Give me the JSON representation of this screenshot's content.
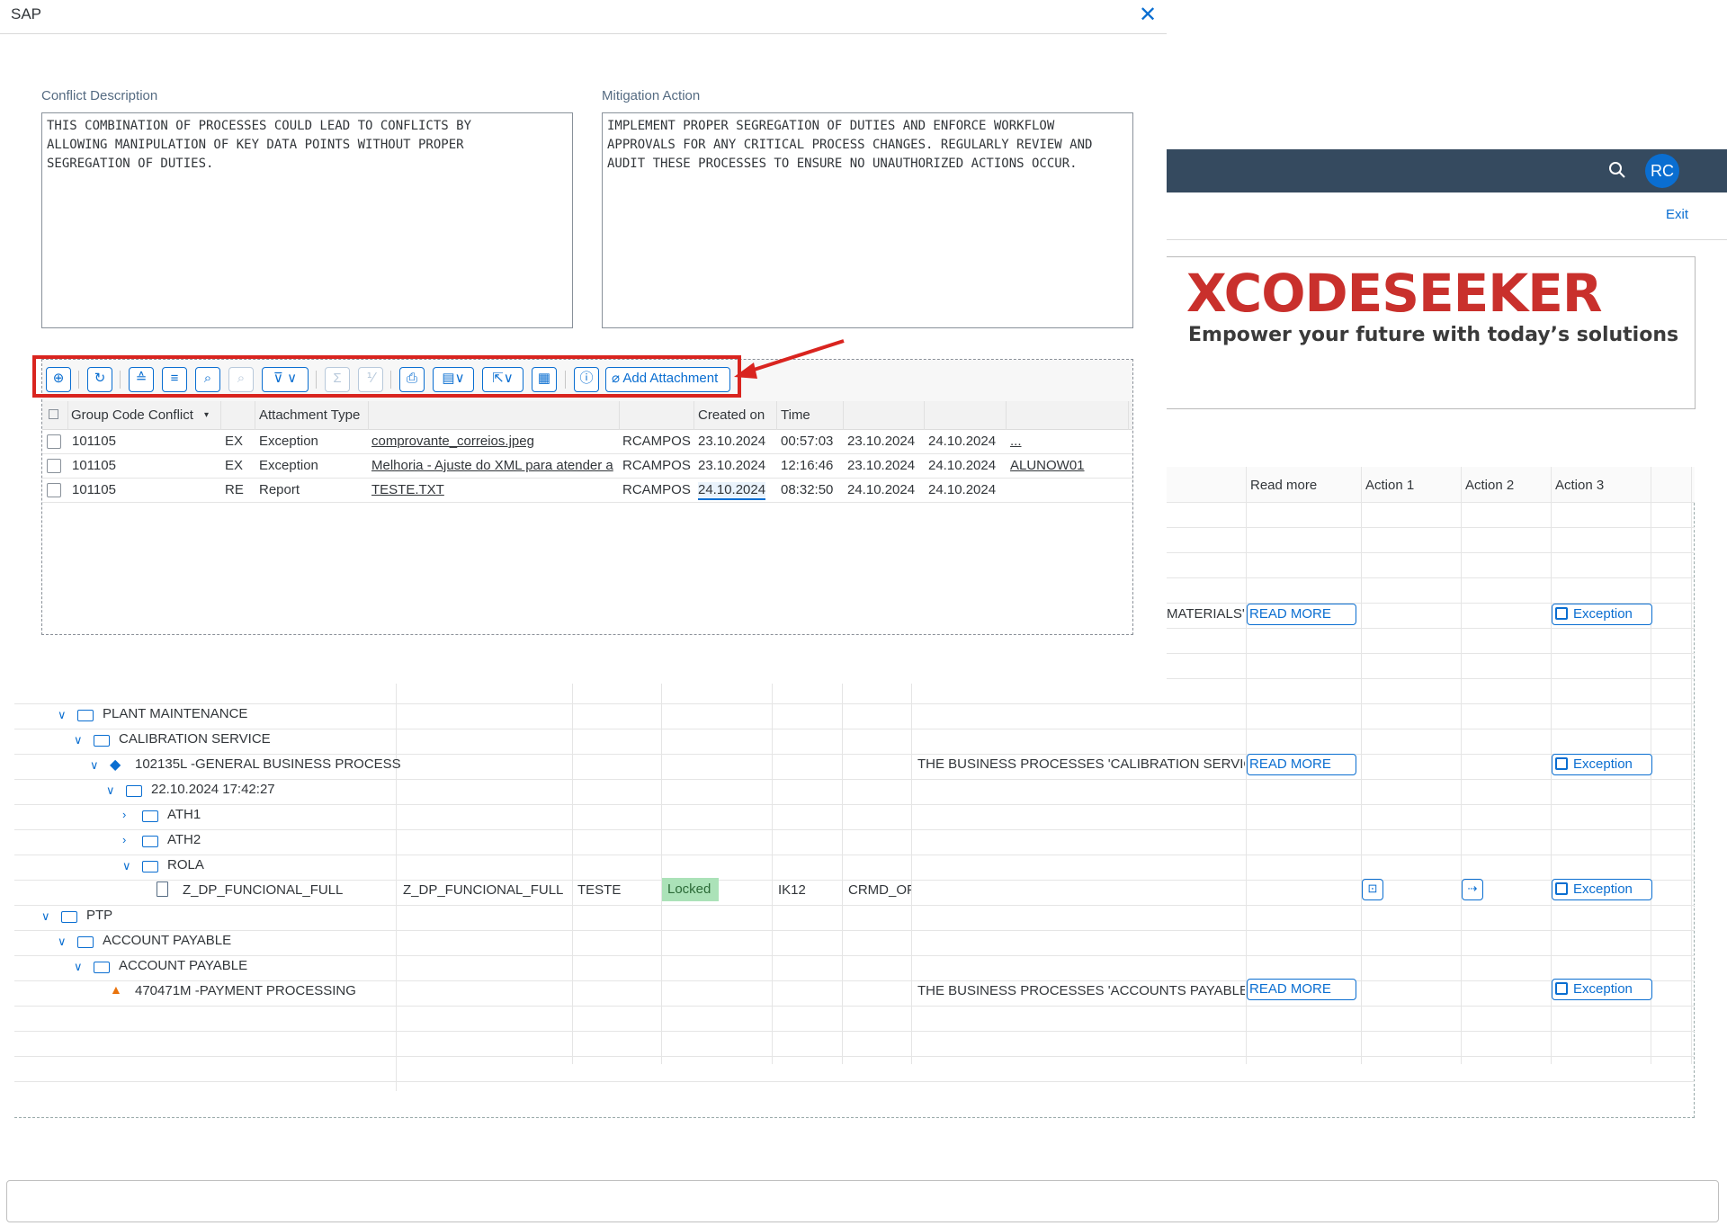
{
  "dialog": {
    "title": "SAP",
    "close_icon": "close-icon",
    "conflict_label": "Conflict Description",
    "conflict_text": "THIS COMBINATION OF PROCESSES COULD LEAD TO CONFLICTS BY\nALLOWING MANIPULATION OF KEY DATA POINTS WITHOUT PROPER\nSEGREGATION OF DUTIES.",
    "mitigation_label": "Mitigation Action",
    "mitigation_text": "IMPLEMENT PROPER SEGREGATION OF DUTIES AND ENFORCE WORKFLOW\nAPPROVALS FOR ANY CRITICAL PROCESS CHANGES. REGULARLY REVIEW AND\nAUDIT THESE PROCESSES TO ENSURE NO UNAUTHORIZED ACTIONS OCCUR."
  },
  "toolbar": {
    "add_attachment": "Add Attachment",
    "icons": [
      "details-icon",
      "refresh-icon",
      "sort-ascending-icon",
      "sort-descending-icon",
      "find-icon",
      "find-next-icon",
      "filter-icon",
      "sum-icon",
      "subtotal-icon",
      "print-icon",
      "view-icon",
      "export-icon",
      "layout-icon",
      "info-icon",
      "paperclip-icon"
    ]
  },
  "attachments": {
    "headers": {
      "group": "Group Code Conflict",
      "type": "Attachment Type",
      "created": "Created on",
      "time": "Time"
    },
    "rows": [
      {
        "group": "101105",
        "code": "EX",
        "type": "Exception",
        "file": "comprovante_correios.jpeg",
        "user": "RCAMPOS",
        "created": "23.10.2024",
        "time": "00:57:03",
        "d1": "23.10.2024",
        "d2": "24.10.2024",
        "extra": "..."
      },
      {
        "group": "101105",
        "code": "EX",
        "type": "Exception",
        "file": "Melhoria - Ajuste do XML para atender a",
        "user": "RCAMPOS",
        "created": "23.10.2024",
        "time": "12:16:46",
        "d1": "23.10.2024",
        "d2": "24.10.2024",
        "extra": "ALUNOW01"
      },
      {
        "group": "101105",
        "code": "RE",
        "type": "Report",
        "file": "TESTE.TXT",
        "user": "RCAMPOS",
        "created": "24.10.2024",
        "time": "08:32:50",
        "d1": "24.10.2024",
        "d2": "24.10.2024",
        "extra": ""
      }
    ]
  },
  "app": {
    "avatar": "RC",
    "exit": "Exit",
    "logo_title": "XCODESEEKER",
    "logo_tag": "Empower your future with today’s solutions",
    "columns": {
      "read_more": "Read more",
      "action1": "Action 1",
      "action2": "Action 2",
      "action3": "Action 3"
    },
    "read_more_label": "READ MORE",
    "exception_label": "Exception",
    "materials_text": "MATERIALS'",
    "tree": [
      {
        "label": "PLANT MAINTENANCE"
      },
      {
        "label": "CALIBRATION SERVICE"
      },
      {
        "label": "102135L -GENERAL BUSINESS PROCESS",
        "desc": "THE BUSINESS PROCESSES 'CALIBRATION SERVIC"
      },
      {
        "label": "22.10.2024 17:42:27"
      },
      {
        "label": "ATH1"
      },
      {
        "label": "ATH2"
      },
      {
        "label": "ROLA"
      },
      {
        "label": "Z_DP_FUNCIONAL_FULL",
        "role": "Z_DP_FUNCIONAL_FULL",
        "user": "TESTE",
        "status": "Locked",
        "sys": "IK12",
        "obj": "CRMD_OF"
      },
      {
        "label": "PTP"
      },
      {
        "label": "ACCOUNT PAYABLE"
      },
      {
        "label": "ACCOUNT PAYABLE"
      },
      {
        "label": "470471M -PAYMENT PROCESSING",
        "desc": "THE BUSINESS PROCESSES 'ACCOUNTS PAYABLE -"
      }
    ]
  }
}
